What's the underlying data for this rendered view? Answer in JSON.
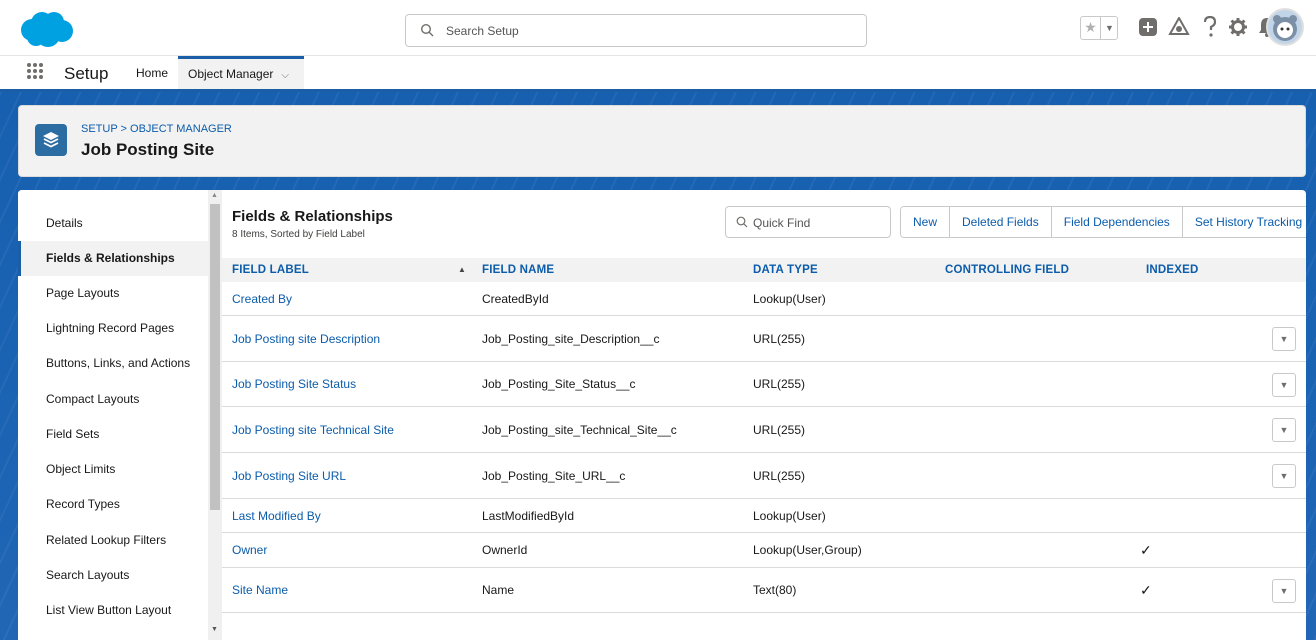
{
  "header": {
    "search_placeholder": "Search Setup",
    "icons": [
      "favorites-star-icon",
      "favorites-dropdown-icon",
      "global-actions-icon",
      "trailhead-icon",
      "help-icon",
      "setup-gear-icon",
      "notifications-bell-icon",
      "user-avatar"
    ]
  },
  "nav": {
    "app_name": "Setup",
    "tabs": [
      {
        "label": "Home"
      },
      {
        "label": "Object Manager"
      }
    ]
  },
  "page_header": {
    "breadcrumb": "SETUP > OBJECT MANAGER",
    "title": "Job Posting Site"
  },
  "sidebar": {
    "items": [
      {
        "label": "Details"
      },
      {
        "label": "Fields & Relationships"
      },
      {
        "label": "Page Layouts"
      },
      {
        "label": "Lightning Record Pages"
      },
      {
        "label": "Buttons, Links, and Actions"
      },
      {
        "label": "Compact Layouts"
      },
      {
        "label": "Field Sets"
      },
      {
        "label": "Object Limits"
      },
      {
        "label": "Record Types"
      },
      {
        "label": "Related Lookup Filters"
      },
      {
        "label": "Search Layouts"
      },
      {
        "label": "List View Button Layout"
      }
    ]
  },
  "main": {
    "title": "Fields & Relationships",
    "subtitle": "8 Items, Sorted by Field Label",
    "quick_find_placeholder": "Quick Find",
    "buttons": [
      {
        "label": "New"
      },
      {
        "label": "Deleted Fields"
      },
      {
        "label": "Field Dependencies"
      },
      {
        "label": "Set History Tracking"
      }
    ],
    "columns": [
      "FIELD LABEL",
      "FIELD NAME",
      "DATA TYPE",
      "CONTROLLING FIELD",
      "INDEXED"
    ],
    "rows": [
      {
        "label": "Created By",
        "name": "CreatedById",
        "type": "Lookup(User)",
        "controlling": "",
        "indexed": false,
        "action": false
      },
      {
        "label": "Job Posting site Description",
        "name": "Job_Posting_site_Description__c",
        "type": "URL(255)",
        "controlling": "",
        "indexed": false,
        "action": true
      },
      {
        "label": "Job Posting Site Status",
        "name": "Job_Posting_Site_Status__c",
        "type": "URL(255)",
        "controlling": "",
        "indexed": false,
        "action": true
      },
      {
        "label": "Job Posting site Technical Site",
        "name": "Job_Posting_site_Technical_Site__c",
        "type": "URL(255)",
        "controlling": "",
        "indexed": false,
        "action": true
      },
      {
        "label": "Job Posting Site URL",
        "name": "Job_Posting_Site_URL__c",
        "type": "URL(255)",
        "controlling": "",
        "indexed": false,
        "action": true
      },
      {
        "label": "Last Modified By",
        "name": "LastModifiedById",
        "type": "Lookup(User)",
        "controlling": "",
        "indexed": false,
        "action": false
      },
      {
        "label": "Owner",
        "name": "OwnerId",
        "type": "Lookup(User,Group)",
        "controlling": "",
        "indexed": true,
        "action": false
      },
      {
        "label": "Site Name",
        "name": "Name",
        "type": "Text(80)",
        "controlling": "",
        "indexed": true,
        "action": true
      }
    ]
  },
  "colors": {
    "brand_blue": "#1b5ea8",
    "link_blue": "#0b5cab",
    "salesforce_cloud": "#00a1e0"
  }
}
